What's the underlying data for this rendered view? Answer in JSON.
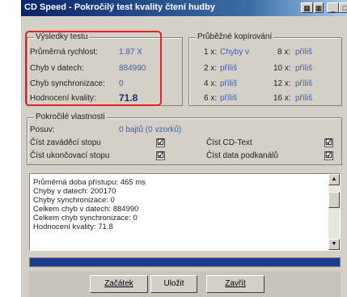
{
  "window": {
    "title": "CD Speed - Pokročilý test kvality čtení hudby",
    "title_icons": [
      "grid-icon",
      "grid-icon"
    ],
    "controls": [
      "minimize",
      "maximize",
      "close"
    ]
  },
  "results": {
    "group_label": "Výsledky testu",
    "rows": [
      {
        "label": "Průměrná rychlost:",
        "value": "1.87 X"
      },
      {
        "label": "Chyb v datech:",
        "value": "884990"
      },
      {
        "label": "Chyb synchronizace:",
        "value": "0"
      },
      {
        "label": "Hodnocení kvality:",
        "value": "71.8"
      }
    ]
  },
  "copying": {
    "group_label": "Průběžné kopírování",
    "cells": [
      {
        "speed": "1 x:",
        "status": "Chyby v"
      },
      {
        "speed": "8 x:",
        "status": "příliš"
      },
      {
        "speed": "2 x:",
        "status": "příliš"
      },
      {
        "speed": "10 x:",
        "status": "příliš"
      },
      {
        "speed": "4 x:",
        "status": "příliš"
      },
      {
        "speed": "12 x:",
        "status": "příliš"
      },
      {
        "speed": "6 x:",
        "status": "příliš"
      },
      {
        "speed": "16 x:",
        "status": "příliš"
      }
    ]
  },
  "advanced": {
    "group_label": "Pokročilé vlastnosti",
    "offset_label": "Posuv:",
    "offset_value": "0 bajtů (0 vzorků)",
    "options": [
      {
        "label": "Číst zaváděcí stopu",
        "checked": "☑"
      },
      {
        "label": "Číst CD-Text",
        "checked": "☑"
      },
      {
        "label": "Číst ukončovací stopu",
        "checked": "☑"
      },
      {
        "label": "Číst data podkanálů",
        "checked": "☑"
      }
    ]
  },
  "log": {
    "lines": [
      "Průměrná doba přístupu:  465 ms",
      "Chyby v datech: 200170",
      "Chyby synchronizace: 0",
      "Celkem chyb v datech: 884990",
      "Celkem chyb synchronizace: 0",
      "Hodnocení kvality: 71.8"
    ]
  },
  "progress": {
    "fraction": 1.0,
    "color": "#1e3a8a"
  },
  "buttons": {
    "start": "Začátek",
    "save": "Uložit",
    "close": "Zavřít"
  },
  "colors": {
    "highlight": "#e0251d",
    "value_text": "#3f5fa8",
    "title_bar": "#0a246a"
  }
}
